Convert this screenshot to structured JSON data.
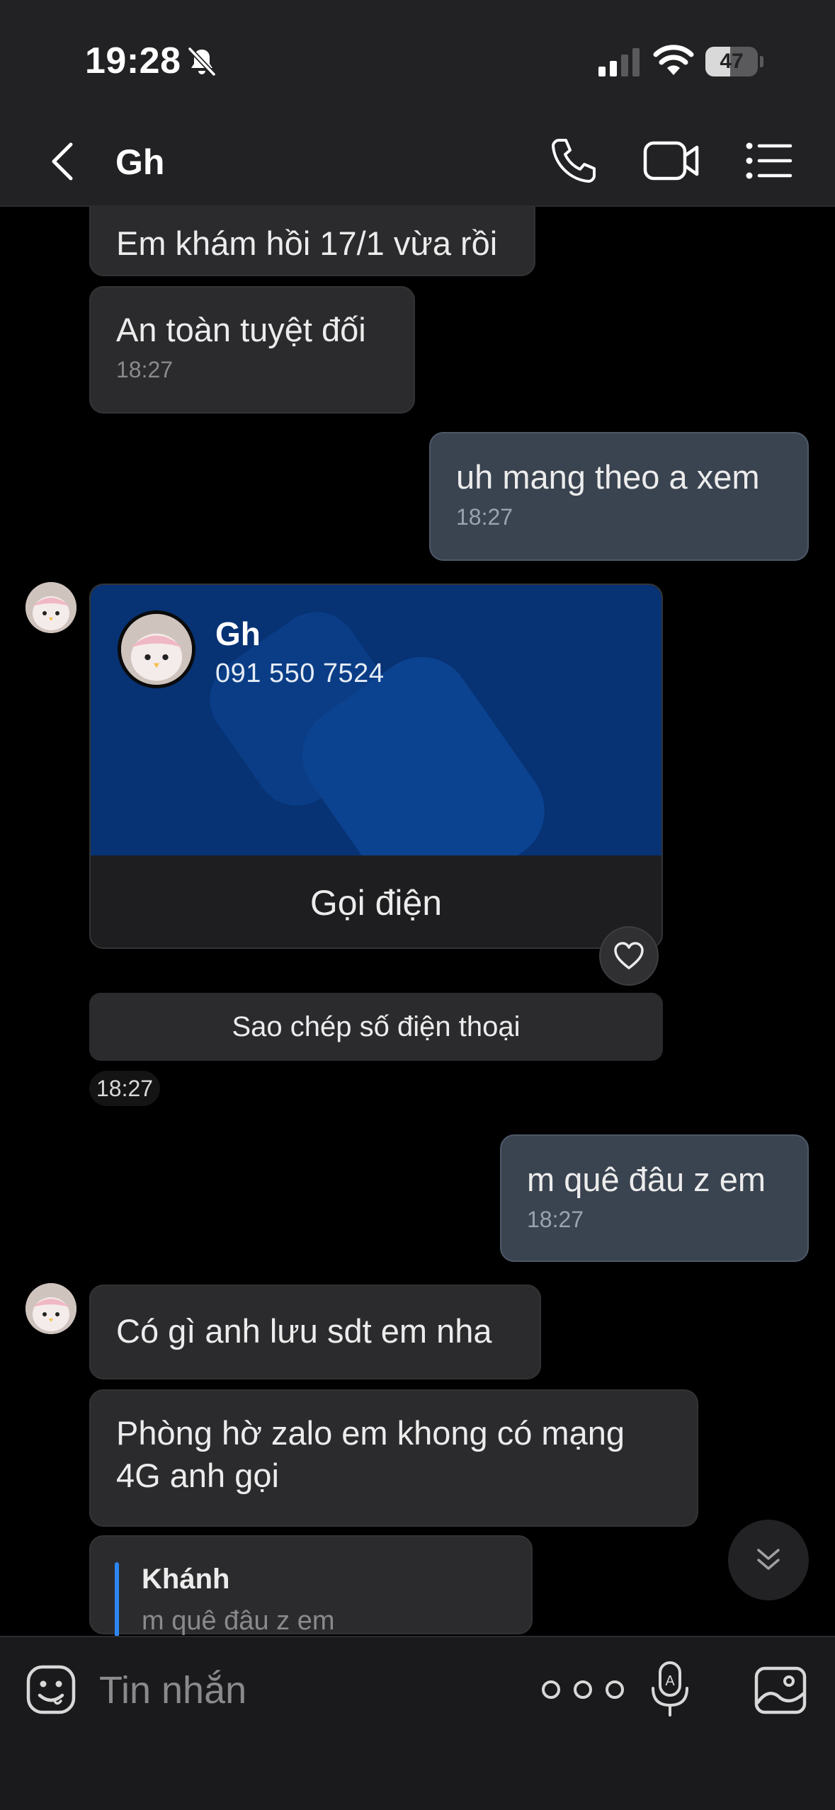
{
  "status_bar": {
    "time": "19:28",
    "battery": "47",
    "battery_level": 0.47
  },
  "header": {
    "title": "Gh"
  },
  "messages": {
    "m1": {
      "text": "Em khám hồi 17/1 vừa rồi"
    },
    "m2": {
      "text": "An toàn tuyệt đối",
      "time": "18:27"
    },
    "m3": {
      "text": "uh mang theo a xem",
      "time": "18:27"
    },
    "contact_card": {
      "name": "Gh",
      "phone": "091 550 7524",
      "call_label": "Gọi điện"
    },
    "copy_label": "Sao chép số điện thoại",
    "card_time": "18:27",
    "m4": {
      "text": "m quê đâu z em",
      "time": "18:27"
    },
    "m5": {
      "text": "Có gì anh lưu sdt em nha"
    },
    "m6": {
      "text": "Phòng hờ zalo em khong có mạng 4G anh gọi"
    },
    "reply": {
      "name": "Khánh",
      "text": "m quê đâu z em"
    }
  },
  "composer": {
    "placeholder": "Tin nhắn"
  },
  "colors": {
    "my_bubble": "#3a4350",
    "their_bubble": "#2b2b2d",
    "card_blue": "#073273",
    "accent": "#2d86f0"
  },
  "icons": [
    "bell-off-icon",
    "signal-icon",
    "wifi-icon",
    "battery-icon",
    "back-icon",
    "phone-icon",
    "video-icon",
    "list-icon",
    "heart-icon",
    "chevrons-down-icon",
    "emoji-icon",
    "more-icon",
    "mic-icon",
    "image-icon"
  ]
}
